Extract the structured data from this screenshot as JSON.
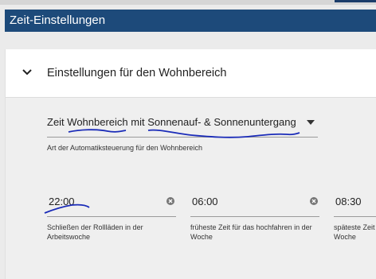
{
  "header": {
    "title": "Zeit-Einstellungen"
  },
  "section": {
    "title": "Einstellungen für den Wohnbereich"
  },
  "automation": {
    "value": "Zeit Wohnbereich mit Sonnenauf- & Sonnenuntergang",
    "helper": "Art der Automatiksteuerung für den Wohnbereich"
  },
  "times": [
    {
      "value": "22:00",
      "helper": "Schließen der Rollläden in der Arbeitswoche"
    },
    {
      "value": "06:00",
      "helper": "früheste Zeit für das hochfahren in der Woche"
    },
    {
      "value": "08:30",
      "helper": "späteste Zeit in der Woche"
    }
  ],
  "colors": {
    "header": "#1d4a7a",
    "annotation": "#1a2bb8"
  }
}
